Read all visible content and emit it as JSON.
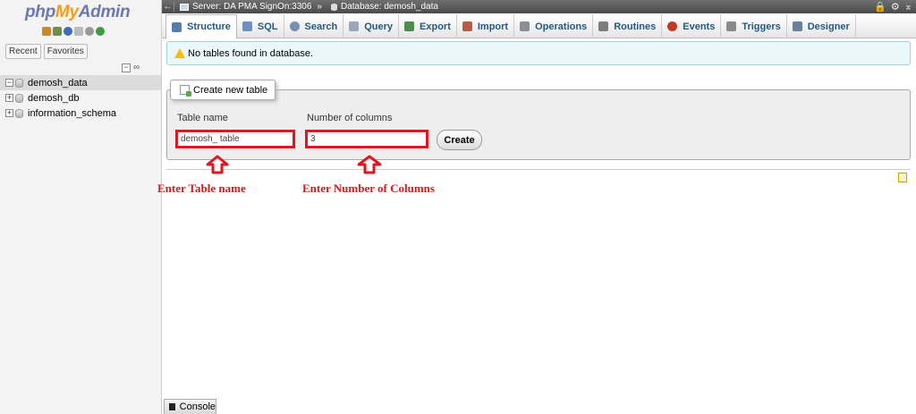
{
  "nav": {
    "logo": {
      "part1": "php",
      "part2": "My",
      "part3": "Admin"
    },
    "tabs": {
      "recent": "Recent",
      "favorites": "Favorites"
    },
    "databases": [
      {
        "name": "demosh_data",
        "expander": "−",
        "active": true
      },
      {
        "name": "demosh_db",
        "expander": "+",
        "active": false
      },
      {
        "name": "information_schema",
        "expander": "+",
        "active": false
      }
    ]
  },
  "topbar": {
    "server": "Server: DA PMA SignOn:3306",
    "separator": "»",
    "database": "Database: demosh_data"
  },
  "tabs": [
    {
      "label": "Structure",
      "icon": "structure-icon",
      "color": "#5a7da8"
    },
    {
      "label": "SQL",
      "icon": "sql-icon",
      "color": "#6e8fbf"
    },
    {
      "label": "Search",
      "icon": "search-icon",
      "color": "#7a8fae"
    },
    {
      "label": "Query",
      "icon": "query-icon",
      "color": "#9aa7b8"
    },
    {
      "label": "Export",
      "icon": "export-icon",
      "color": "#4f8a4f"
    },
    {
      "label": "Import",
      "icon": "import-icon",
      "color": "#b85c4a"
    },
    {
      "label": "Operations",
      "icon": "wrench-icon",
      "color": "#8a8f96"
    },
    {
      "label": "Routines",
      "icon": "routines-icon",
      "color": "#7d7d7d"
    },
    {
      "label": "Events",
      "icon": "clock-icon",
      "color": "#c0392b"
    },
    {
      "label": "Triggers",
      "icon": "triggers-icon",
      "color": "#8a8a8a"
    },
    {
      "label": "Designer",
      "icon": "designer-icon",
      "color": "#6b7f99"
    }
  ],
  "notice": {
    "text": "No tables found in database."
  },
  "create_table": {
    "legend": "Create new table",
    "table_name_label": "Table name",
    "table_name_value": "demosh_ table",
    "columns_label": "Number of columns",
    "columns_value": "3",
    "button": "Create"
  },
  "annotations": {
    "table_name": "Enter Table name",
    "columns": "Enter Number of Columns"
  },
  "console": {
    "label": "Console"
  },
  "colors": {
    "annotation_red": "#e3141d",
    "link_blue": "#235a81"
  }
}
